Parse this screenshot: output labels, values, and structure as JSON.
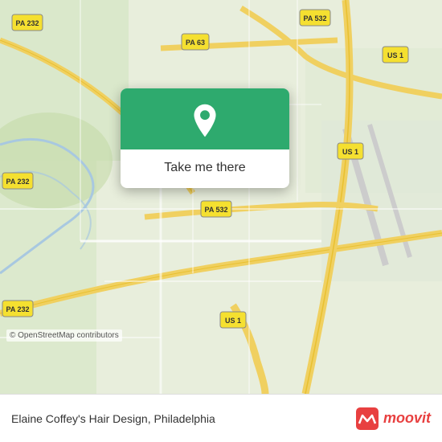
{
  "map": {
    "copyright": "© OpenStreetMap contributors",
    "background_color": "#e8f0e0"
  },
  "popup": {
    "button_label": "Take me there",
    "green_color": "#2eaa6e"
  },
  "bottom_bar": {
    "location_text": "Elaine Coffey's Hair Design, Philadelphia",
    "brand_name": "moovit"
  },
  "road_labels": {
    "pa_232_top": "PA 232",
    "pa_63": "PA 63",
    "pa_532_top": "PA 532",
    "us_1_right": "US 1",
    "pa_232_left": "PA 232",
    "us_1_mid": "US 1",
    "pa_532_mid": "PA 532",
    "pa_232_bottom": "PA 232",
    "us_1_bottom": "US 1"
  }
}
